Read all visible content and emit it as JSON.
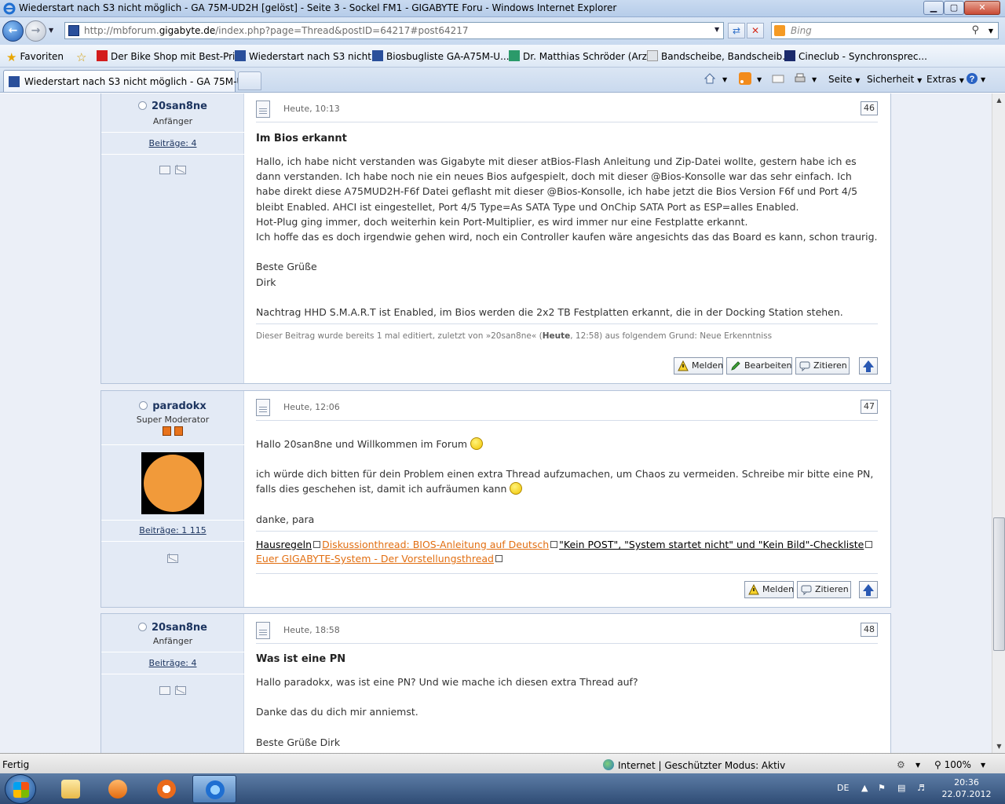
{
  "window": {
    "title": "Wiederstart nach S3 nicht möglich - GA 75M-UD2H [gelöst] - Seite 3 - Sockel FM1 - GIGABYTE Foru - Windows Internet Explorer",
    "min_label": "▁",
    "max_label": "▢",
    "close_label": "✕"
  },
  "address": {
    "url_prefix": "http://mbforum.",
    "url_domain": "gigabyte.de",
    "url_suffix": "/index.php?page=Thread&postID=64217#post64217",
    "search_placeholder": "Bing"
  },
  "favorites": {
    "favorites_label": "Favoriten",
    "items": [
      "Der Bike Shop mit Best-Pri...",
      "Wiederstart nach S3 nicht ...",
      "Biosbugliste GA-A75M-U...",
      "Dr. Matthias Schröder (Arz...",
      "Bandscheibe, Bandscheib...",
      "Cineclub - Synchronsprec..."
    ]
  },
  "tabs": {
    "active_label": "Wiederstart nach S3 nicht möglich - GA 75M-UD...",
    "cmd_seite": "Seite",
    "cmd_sicherheit": "Sicherheit",
    "cmd_extras": "Extras"
  },
  "posts": [
    {
      "username": "20san8ne",
      "rank": "Anfänger",
      "posts_count": "Beiträge: 4",
      "date": "Heute, 10:13",
      "number": "46",
      "title": "Im Bios erkannt",
      "body": "Hallo, ich habe nicht verstanden was Gigabyte mit dieser atBios-Flash Anleitung und Zip-Datei wollte, gestern habe ich es dann verstanden. Ich habe noch nie ein neues Bios aufgespielt, doch mit dieser @Bios-Konsolle war das sehr einfach. Ich habe direkt diese A75MUD2H-F6f Datei geflasht mit dieser @Bios-Konsolle, ich habe jetzt die Bios Version F6f und Port 4/5 bleibt Enabled. AHCI ist eingestellet, Port 4/5 Type=As SATA Type und OnChip SATA Port as ESP=alles Enabled.\nHot-Plug ging immer, doch weiterhin kein Port-Multiplier, es wird immer nur eine Festplatte erkannt.\nIch hoffe das es doch irgendwie gehen wird, noch ein Controller kaufen wäre angesichts das das Board es kann, schon traurig.\n\nBeste Grüße\nDirk\n\nNachtrag HHD S.M.A.R.T ist Enabled, im Bios werden die 2x2 TB Festplatten erkannt, die in der Docking Station stehen.",
      "edit_note_prefix": "Dieser Beitrag wurde bereits 1 mal editiert, zuletzt von »20san8ne« (",
      "edit_note_time": "Heute",
      "edit_note_suffix": ", 12:58) aus folgendem Grund: Neue Erkenntniss",
      "btn_report": "Melden",
      "btn_edit": "Bearbeiten",
      "btn_quote": "Zitieren"
    },
    {
      "username": "paradokx",
      "rank": "Super Moderator",
      "posts_count": "Beiträge: 1 115",
      "date": "Heute, 12:06",
      "number": "47",
      "line1": "Hallo 20san8ne und Willkommen im Forum",
      "line2": "ich würde dich bitten für dein Problem einen extra Thread aufzumachen, um Chaos zu vermeiden. Schreibe mir bitte eine PN, falls dies geschehen ist, damit ich aufräumen kann",
      "line3": "danke, para",
      "sig_link1": "Hausregeln",
      "sig_link2": "Diskussionthread: BIOS-Anleitung auf Deutsch",
      "sig_link3": "\"Kein POST\", \"System startet nicht\" und \"Kein Bild\"-Checkliste",
      "sig_link4": "Euer GIGABYTE-System - Der Vorstellungsthread",
      "btn_report": "Melden",
      "btn_quote": "Zitieren"
    },
    {
      "username": "20san8ne",
      "rank": "Anfänger",
      "posts_count": "Beiträge: 4",
      "date": "Heute, 18:58",
      "number": "48",
      "title": "Was ist eine PN",
      "body": "Hallo paradokx, was ist eine PN? Und wie mache ich diesen extra Thread auf?\n\nDanke das du dich mir anniemst.\n\nBeste Grüße Dirk"
    }
  ],
  "statusbar": {
    "left": "Fertig",
    "zone": "Internet | Geschützter Modus: Aktiv",
    "zoom": "100%"
  },
  "taskbar": {
    "lang": "DE",
    "time": "20:36",
    "date": "22.07.2012"
  },
  "colors": {
    "accent_link": "#e26f12",
    "username": "#1d3560",
    "content_bg": "#ebeff7"
  }
}
